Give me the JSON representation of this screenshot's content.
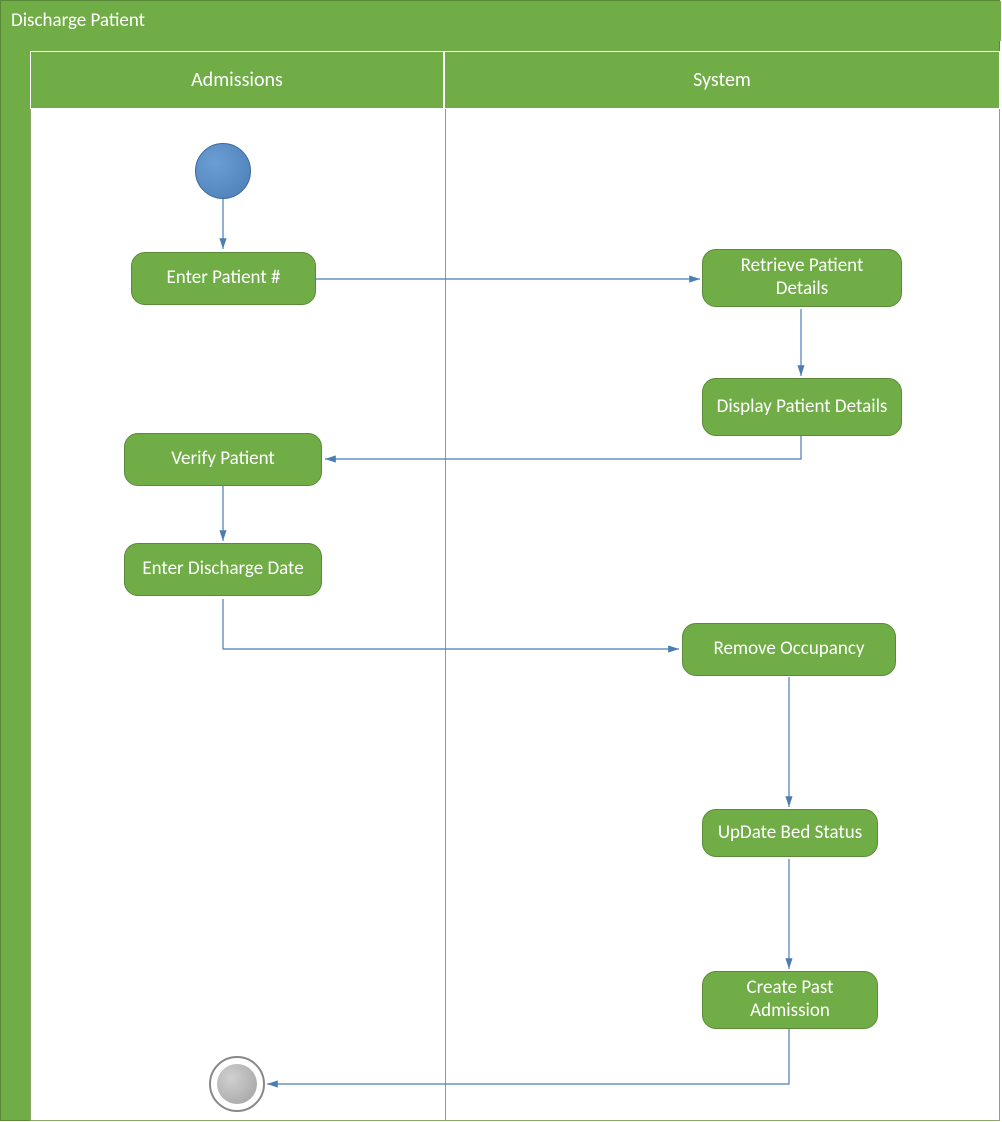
{
  "diagram": {
    "title": "Discharge Patient",
    "lanes": {
      "admissions": "Admissions",
      "system": "System"
    },
    "nodes": {
      "start": {
        "type": "start"
      },
      "enter_patient_no": {
        "label": "Enter Patient #"
      },
      "retrieve_patient_details": {
        "label": "Retrieve Patient Details"
      },
      "display_patient_details": {
        "label": "Display Patient Details"
      },
      "verify_patient": {
        "label": "Verify Patient"
      },
      "enter_discharge_date": {
        "label": "Enter Discharge Date"
      },
      "remove_occupancy": {
        "label": "Remove  Occupancy"
      },
      "update_bed_status": {
        "label": "UpDate Bed Status"
      },
      "create_past_admission": {
        "label": "Create Past Admission"
      },
      "end": {
        "type": "end"
      }
    },
    "edges": [
      [
        "start",
        "enter_patient_no"
      ],
      [
        "enter_patient_no",
        "retrieve_patient_details"
      ],
      [
        "retrieve_patient_details",
        "display_patient_details"
      ],
      [
        "display_patient_details",
        "verify_patient"
      ],
      [
        "verify_patient",
        "enter_discharge_date"
      ],
      [
        "enter_discharge_date",
        "remove_occupancy"
      ],
      [
        "remove_occupancy",
        "update_bed_status"
      ],
      [
        "update_bed_status",
        "create_past_admission"
      ],
      [
        "create_past_admission",
        "end"
      ]
    ],
    "colors": {
      "green": "#70ad47",
      "green_border": "#5a8a38",
      "blue_start": "#4a7db5",
      "connector": "#4a7db5",
      "gray_end": "#a0a0a0"
    }
  }
}
